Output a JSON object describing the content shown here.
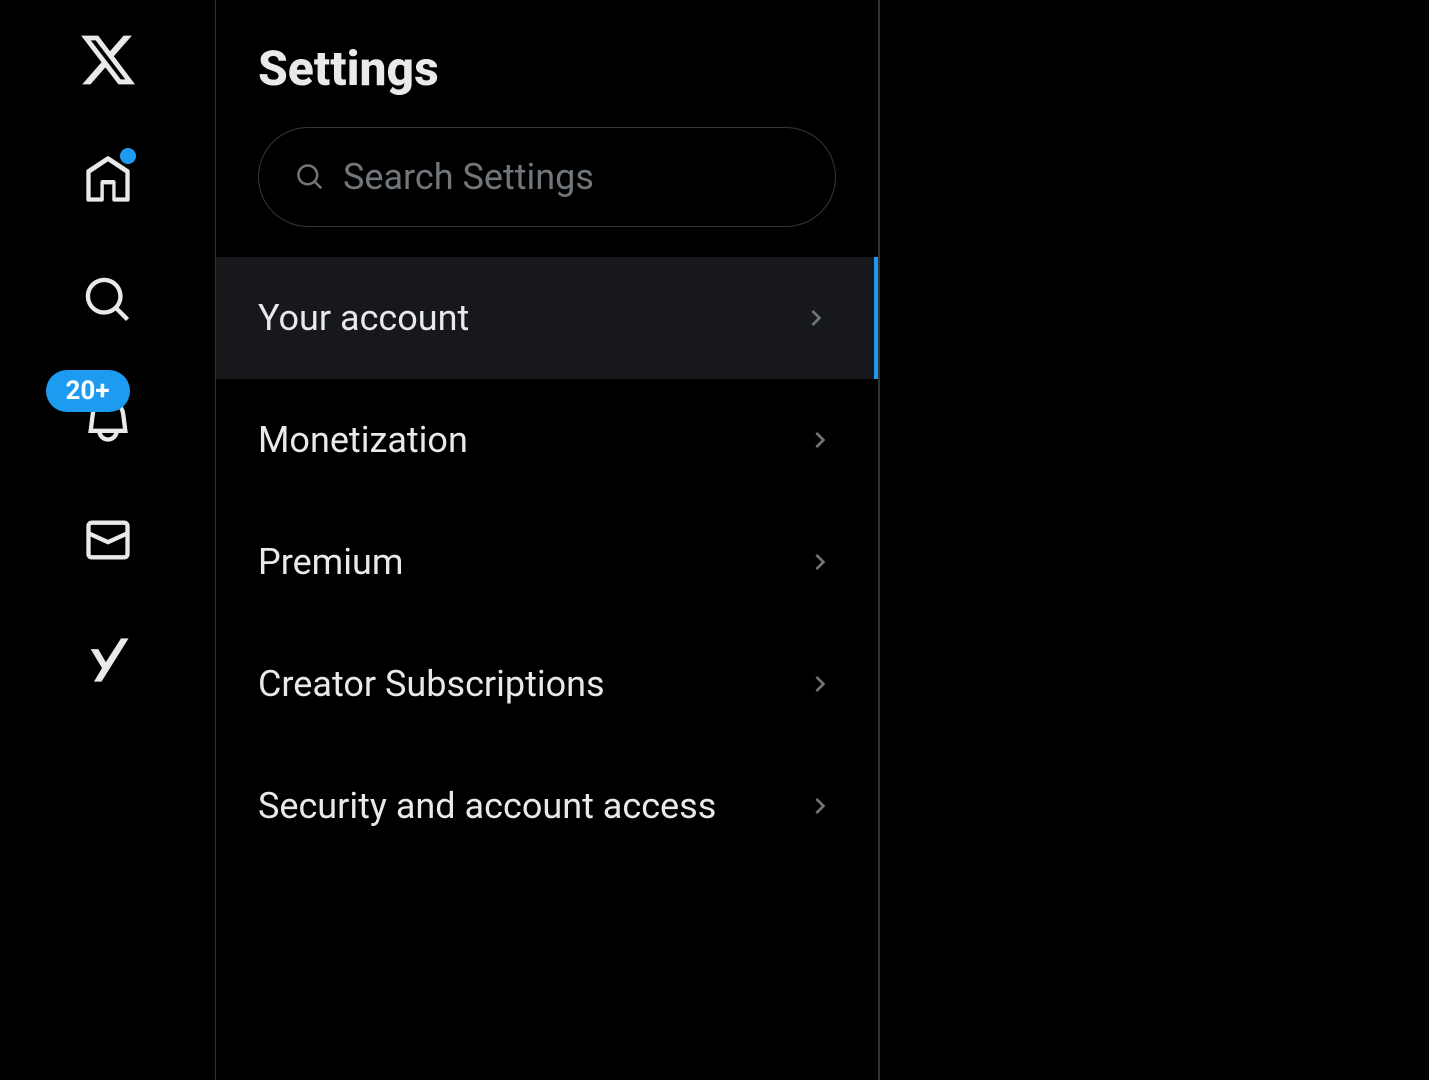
{
  "nav": {
    "notification_badge": "20+"
  },
  "settings": {
    "title": "Settings",
    "search_placeholder": "Search Settings",
    "items": [
      {
        "label": "Your account",
        "active": true
      },
      {
        "label": "Monetization",
        "active": false
      },
      {
        "label": "Premium",
        "active": false
      },
      {
        "label": "Creator Subscriptions",
        "active": false
      },
      {
        "label": "Security and account access",
        "active": false
      }
    ]
  },
  "colors": {
    "accent": "#1d9bf0",
    "background": "#000000",
    "text": "#e7e9ea",
    "muted": "#71767b",
    "border": "#2f3336",
    "active_bg": "#16181c"
  }
}
